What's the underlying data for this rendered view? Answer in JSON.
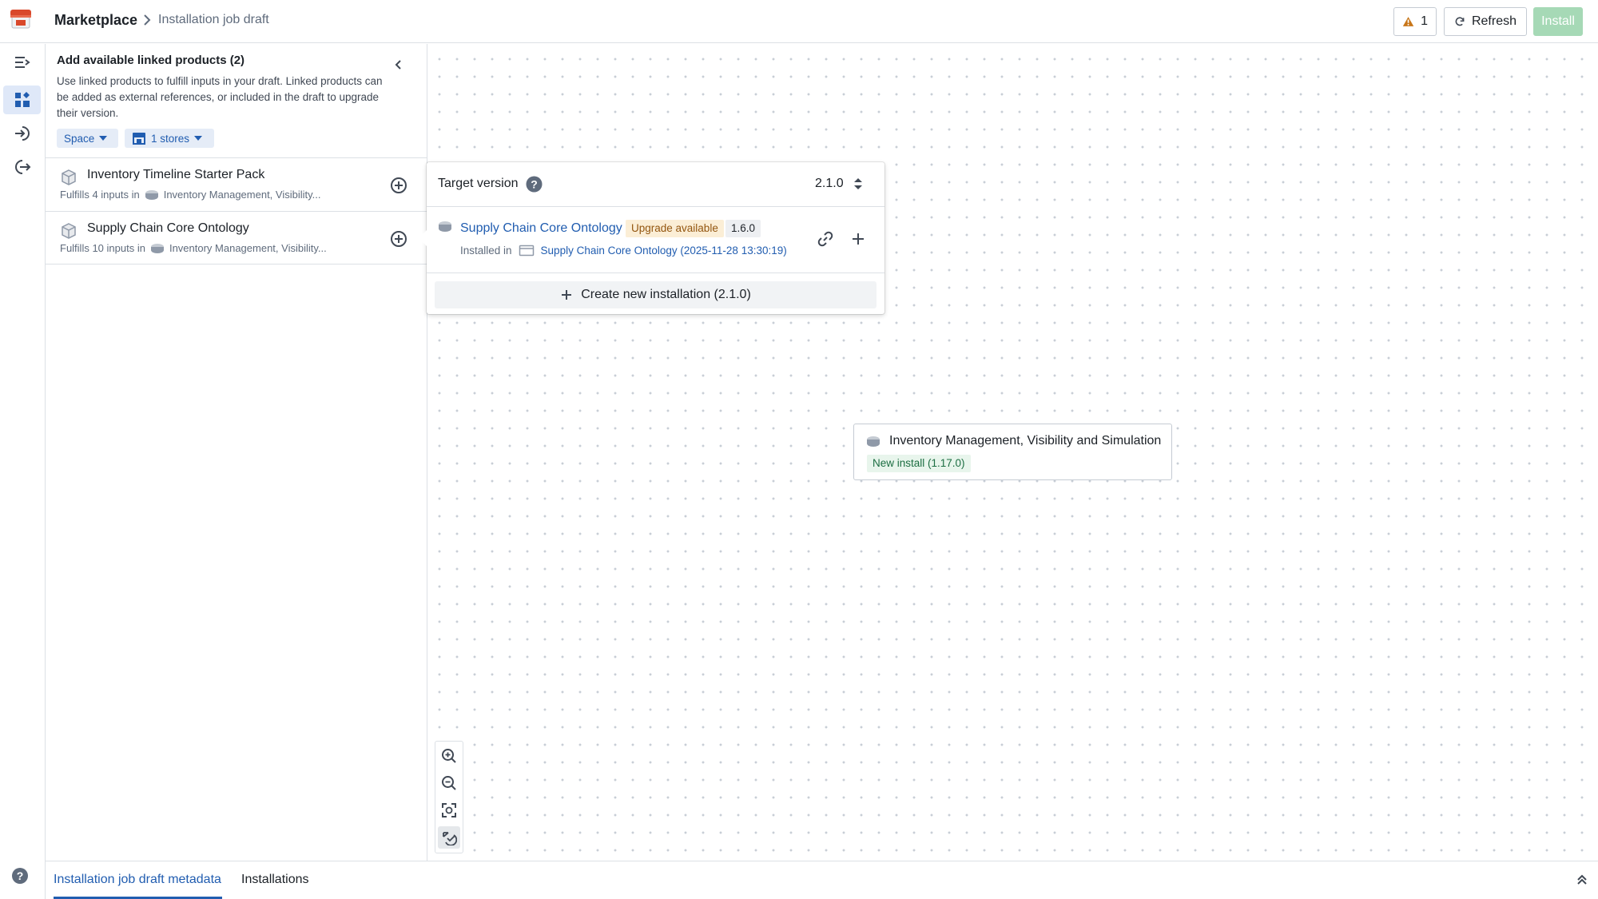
{
  "header": {
    "breadcrumb_root": "Marketplace",
    "breadcrumb_leaf": "Installation job draft",
    "warning_count": "1",
    "refresh_label": "Refresh",
    "install_label": "Install"
  },
  "rail": {
    "items": [
      {
        "icon": "collapse-menu-icon"
      },
      {
        "icon": "graph-layout-icon",
        "active": true
      },
      {
        "icon": "inputs-icon"
      },
      {
        "icon": "outputs-icon"
      }
    ]
  },
  "panel": {
    "title": "Add available linked products (2)",
    "description": "Use linked products to fulfill inputs in your draft. Linked products can be added as external references, or included in the draft to upgrade their version.",
    "filter_space": "Space",
    "filter_stores": "1 stores",
    "products": [
      {
        "name": "Inventory Timeline Starter Pack",
        "fulfills": "Fulfills 4 inputs in",
        "target": "Inventory Management, Visibility..."
      },
      {
        "name": "Supply Chain Core Ontology",
        "fulfills": "Fulfills 10 inputs in",
        "target": "Inventory Management, Visibility..."
      }
    ]
  },
  "popover": {
    "target_version_label": "Target version",
    "target_version_value": "2.1.0",
    "product_name": "Supply Chain Core Ontology",
    "upgrade_tag": "Upgrade available",
    "current_version": "1.6.0",
    "installed_in_label": "Installed in",
    "installed_in_link": "Supply Chain Core Ontology (2025-11-28 13:30:19)",
    "create_label": "Create new installation (2.1.0)"
  },
  "node": {
    "name": "Inventory Management, Visibility and Simulation",
    "tag": "New install (1.17.0)"
  },
  "bottom": {
    "tab_1": "Installation job draft metadata",
    "tab_2": "Installations"
  },
  "colors": {
    "accent": "#215db0",
    "install_disabled": "#a6d9b6",
    "warning": "#c87619",
    "upgrade_bg": "#fbeed6",
    "new_install_bg": "#e8f5ec"
  }
}
